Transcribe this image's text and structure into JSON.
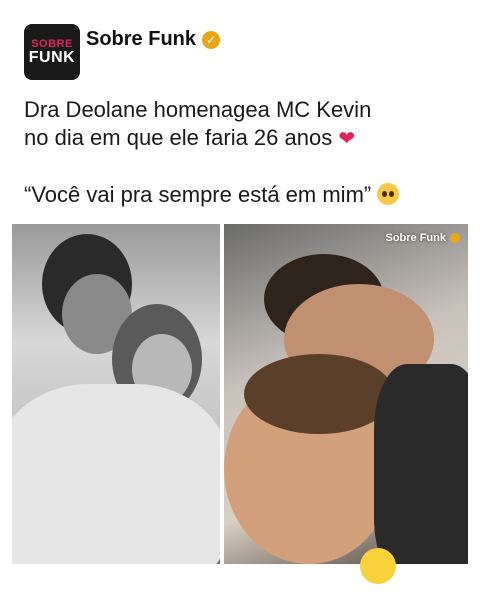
{
  "account": {
    "avatar_line1": "SOBRE",
    "avatar_line2": "FUNK",
    "name": "Sobre Funk",
    "verified_icon": "verified-badge-icon"
  },
  "post": {
    "line1": "Dra Deolane homenagea MC Kevin",
    "line2": "no dia em que ele faria 26 anos",
    "heart_emoji": "❤️",
    "quote": "“Você vai pra sempre está em mim”",
    "quote_emoji": "🥹"
  },
  "photos": {
    "watermark": "Sobre Funk"
  },
  "colors": {
    "background": "#ffffff",
    "verified": "#e6a817",
    "heart": "#e0245e"
  }
}
